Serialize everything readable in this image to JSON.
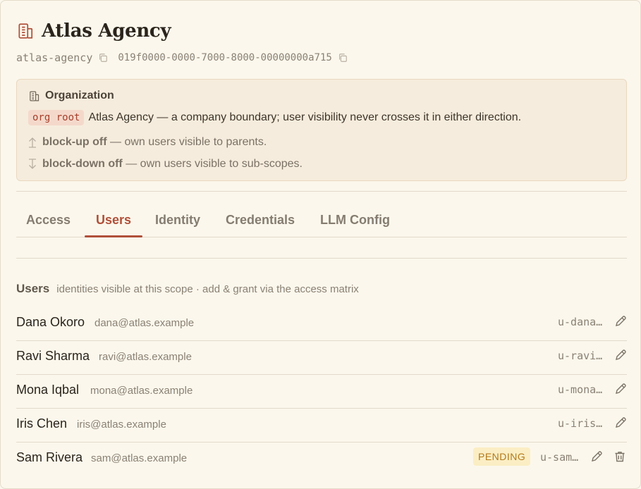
{
  "header": {
    "title": "Atlas Agency",
    "slug": "atlas-agency",
    "uuid": "019f0000-0000-7000-8000-00000000a715"
  },
  "org": {
    "heading": "Organization",
    "pill": "org root",
    "description": "Atlas Agency — a company boundary; user visibility never crosses it in either direction.",
    "block_up_label": "block-up off",
    "block_up_text": "— own users visible to parents.",
    "block_down_label": "block-down off",
    "block_down_text": "— own users visible to sub-scopes."
  },
  "tabs": [
    {
      "label": "Access"
    },
    {
      "label": "Users"
    },
    {
      "label": "Identity"
    },
    {
      "label": "Credentials"
    },
    {
      "label": "LLM Config"
    }
  ],
  "active_tab": "Users",
  "users_section": {
    "title": "Users",
    "subtitle": "identities visible at this scope · add & grant via the access matrix"
  },
  "users": [
    {
      "name": "Dana Okoro",
      "email": "dana@atlas.example",
      "id": "u-dana…"
    },
    {
      "name": "Ravi Sharma",
      "email": "ravi@atlas.example",
      "id": "u-ravi…"
    },
    {
      "name": "Mona Iqbal",
      "email": "mona@atlas.example",
      "id": "u-mona…"
    },
    {
      "name": "Iris Chen",
      "email": "iris@atlas.example",
      "id": "u-iris…"
    },
    {
      "name": "Sam Rivera",
      "email": "sam@atlas.example",
      "id": "u-sam…",
      "badge": "PENDING"
    }
  ],
  "colors": {
    "accent": "#b0503a",
    "pending": "#b27a1d",
    "background": "#fbf7ec"
  },
  "icons": {
    "title": "building-icon",
    "copy": "copy-icon",
    "org": "building-icon",
    "edit": "pencil-icon",
    "delete": "trash-icon"
  }
}
